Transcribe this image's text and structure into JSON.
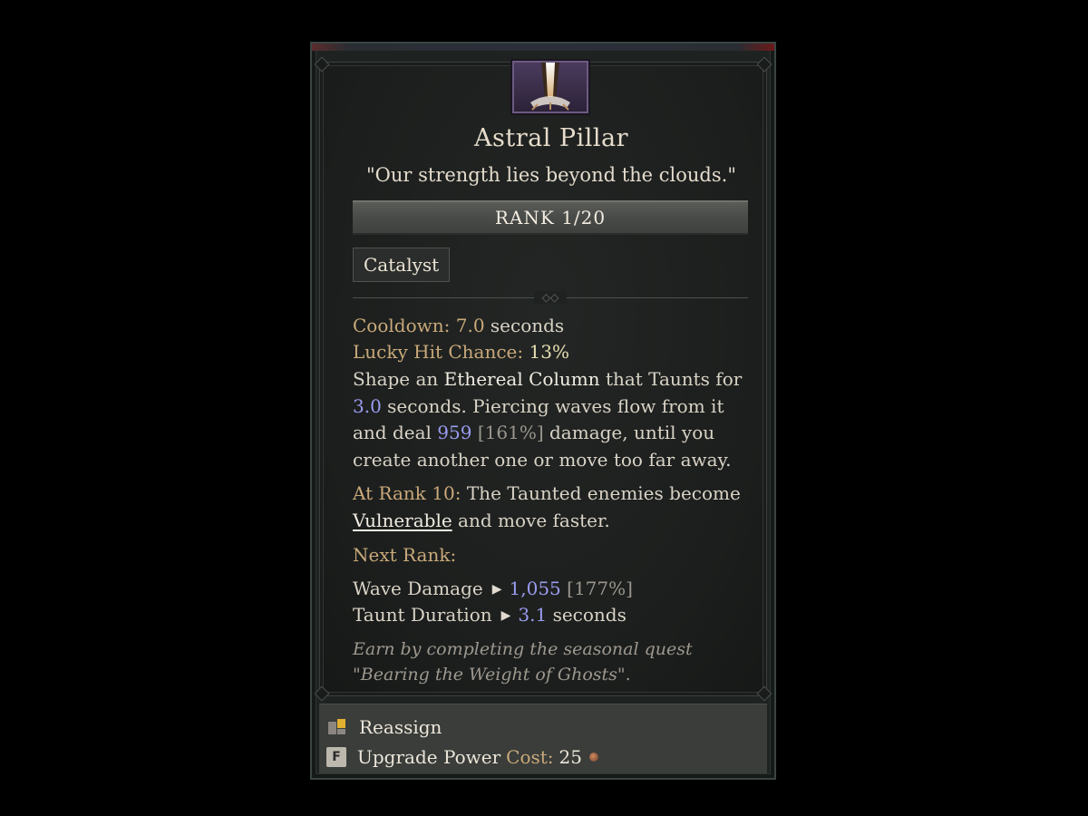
{
  "power": {
    "name": "Astral Pillar",
    "flavor": "\"Our strength lies beyond the clouds.\"",
    "rank_text": "RANK 1/20",
    "tag": "Catalyst"
  },
  "stats": {
    "cooldown_label": "Cooldown:",
    "cooldown_value": "7.0",
    "cooldown_unit": "seconds",
    "lucky_label": "Lucky Hit Chance:",
    "lucky_value": "13%"
  },
  "description": {
    "p1": "Shape an",
    "highlight1": "Ethereal Column",
    "p2": "that Taunts for",
    "taunt_value": "3.0",
    "p3": "seconds. Piercing waves flow from it and deal",
    "damage_value": "959",
    "damage_pct": "[161%]",
    "p4": "damage, until you create another one or move too far away."
  },
  "rank10": {
    "label": "At Rank 10:",
    "p1": "The Taunted enemies become",
    "keyword": "Vulnerable",
    "p2": "and move faster."
  },
  "next_rank": {
    "label": "Next Rank:",
    "rows": [
      {
        "name": "Wave Damage",
        "value": "1,055",
        "extra": "[177%]"
      },
      {
        "name": "Taunt Duration",
        "value": "3.1",
        "extra": "seconds"
      }
    ]
  },
  "note": "Earn by completing the seasonal quest \"Bearing the Weight of Ghosts\".",
  "actions": {
    "reassign_label": "Reassign",
    "upgrade_key": "F",
    "upgrade_label": "Upgrade Power",
    "cost_label": "Cost:",
    "cost_value": "25"
  },
  "colors": {
    "gold_label": "#c9a97a",
    "blue_value": "#9a9cf0",
    "panel_bg": "#1e2321"
  },
  "icons": [
    "astral-pillar-icon",
    "reassign-icon",
    "key-f-icon",
    "currency-icon",
    "arrow-right-icon"
  ]
}
